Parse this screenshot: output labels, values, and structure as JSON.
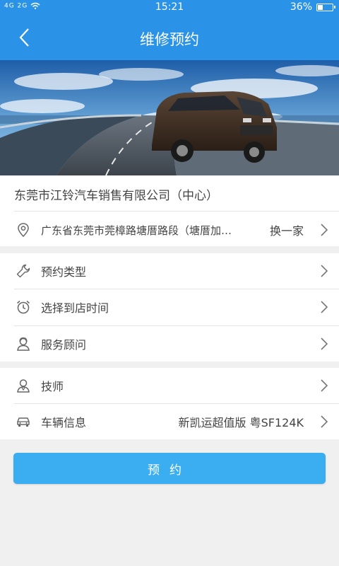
{
  "status_bar": {
    "signal_text": "4G 2G",
    "time": "15:21",
    "battery": "36%",
    "battery_level": 0.36
  },
  "header": {
    "title": "维修预约"
  },
  "company": {
    "name": "东莞市江铃汽车销售有限公司（中心）"
  },
  "address": {
    "text": "广东省东莞市莞樟路塘厝路段（塘厝加…",
    "action_label": "换一家"
  },
  "service_options": [
    {
      "label": "预约类型",
      "icon": "wrench-icon"
    },
    {
      "label": "选择到店时间",
      "icon": "alarm-clock-icon"
    },
    {
      "label": "服务顾问",
      "icon": "advisor-icon"
    }
  ],
  "personnel": {
    "technician_label": "技师",
    "vehicle_label": "车辆信息",
    "vehicle_value": "新凯运超值版 粤SF124K"
  },
  "submit": {
    "label": "预约"
  },
  "colors": {
    "primary": "#2a93e8",
    "button": "#3aaef0",
    "background": "#f0f0f0"
  }
}
